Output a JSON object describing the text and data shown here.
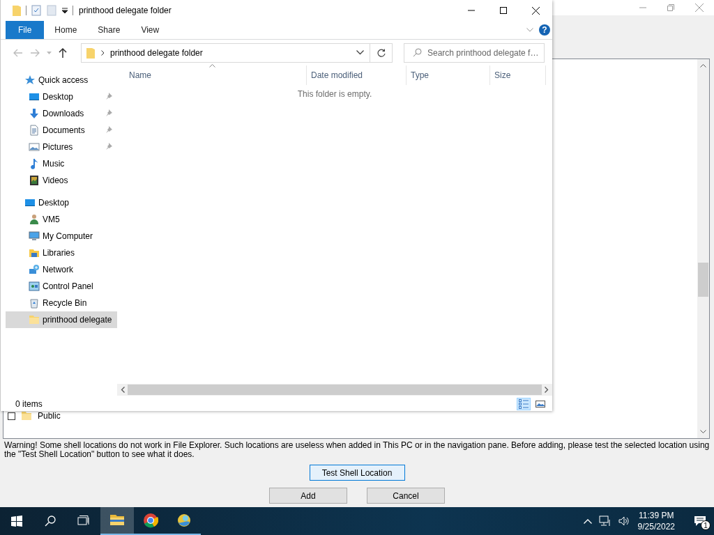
{
  "dialog": {
    "list_items": [
      {
        "label": "Public",
        "checked": false,
        "kind": "folder"
      }
    ],
    "warning": "Warning! Some shell locations do not work in File Explorer. Such locations are useless when added in This PC or in the navigation pane. Before adding, please test the selected location using the \"Test Shell Location\" button to see what it does.",
    "buttons": [
      {
        "label": "Test Shell Location",
        "focused": true
      },
      {
        "label": "Add",
        "focused": false
      },
      {
        "label": "Cancel",
        "focused": false
      }
    ]
  },
  "explorer": {
    "title": "printhood delegate folder",
    "ribbon_tabs": [
      {
        "label": "File",
        "kind": "file"
      },
      {
        "label": "Home",
        "kind": "tab"
      },
      {
        "label": "Share",
        "kind": "tab"
      },
      {
        "label": "View",
        "kind": "tab"
      }
    ],
    "help": "?",
    "address": {
      "path": "printhood delegate folder"
    },
    "search": {
      "placeholder": "Search printhood delegate f…"
    },
    "nav": [
      {
        "label": "Quick access",
        "kind": "star",
        "selected": false,
        "children": [
          {
            "label": "Desktop",
            "kind": "desktop",
            "pinned": true,
            "selected": false
          },
          {
            "label": "Downloads",
            "kind": "downloads",
            "pinned": true,
            "selected": false
          },
          {
            "label": "Documents",
            "kind": "documents",
            "pinned": true,
            "selected": false
          },
          {
            "label": "Pictures",
            "kind": "pictures",
            "pinned": true,
            "selected": false
          },
          {
            "label": "Music",
            "kind": "music",
            "pinned": false,
            "selected": false
          },
          {
            "label": "Videos",
            "kind": "videos",
            "pinned": false,
            "selected": false
          }
        ]
      },
      {
        "label": "Desktop",
        "kind": "desktop",
        "selected": false,
        "children": [
          {
            "label": "VM5",
            "kind": "user",
            "pinned": false,
            "selected": false
          },
          {
            "label": "My Computer",
            "kind": "computer",
            "pinned": false,
            "selected": false
          },
          {
            "label": "Libraries",
            "kind": "libraries",
            "pinned": false,
            "selected": false
          },
          {
            "label": "Network",
            "kind": "network",
            "pinned": false,
            "selected": false
          },
          {
            "label": "Control Panel",
            "kind": "control-panel",
            "pinned": false,
            "selected": false
          },
          {
            "label": "Recycle Bin",
            "kind": "recycle-bin",
            "pinned": false,
            "selected": false
          },
          {
            "label": "printhood delegate",
            "kind": "folder",
            "pinned": false,
            "selected": true
          }
        ]
      }
    ],
    "columns": [
      {
        "label": "Name",
        "sorted": true
      },
      {
        "label": "Date modified",
        "sorted": false
      },
      {
        "label": "Type",
        "sorted": false
      },
      {
        "label": "Size",
        "sorted": false
      }
    ],
    "empty_message": "This folder is empty.",
    "status": "0 items",
    "views": [
      {
        "kind": "details",
        "selected": true
      },
      {
        "kind": "large-icons",
        "selected": false
      }
    ]
  },
  "taskbar": {
    "apps": [
      {
        "kind": "explorer",
        "active": true,
        "running": true
      },
      {
        "kind": "chrome",
        "active": false,
        "running": true
      },
      {
        "kind": "app",
        "active": false,
        "running": true
      }
    ],
    "time": "11:39 PM",
    "date": "9/25/2022",
    "notification_count": "1"
  }
}
